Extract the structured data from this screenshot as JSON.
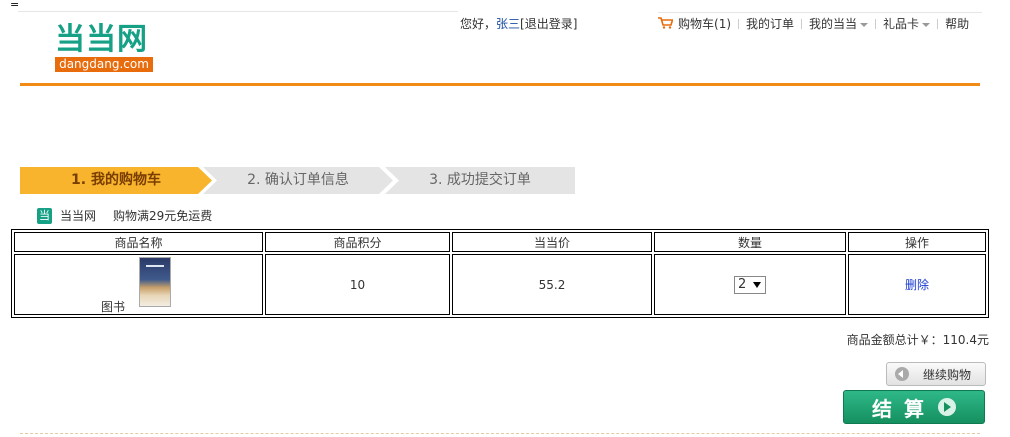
{
  "page": {
    "corner_mark": "="
  },
  "logo": {
    "text": "当当网",
    "sub": "dangdang.com"
  },
  "header": {
    "greeting_prefix": "您好，",
    "username": "张三",
    "logout_label": "[退出登录]"
  },
  "topnav": {
    "cart_label": "购物车",
    "cart_count": "(1)",
    "orders_label": "我的订单",
    "my_dangdang_label": "我的当当",
    "gift_card_label": "礼品卡",
    "help_label": "帮助"
  },
  "steps": [
    {
      "label": "1. 我的购物车",
      "active": true,
      "color": "#f7b42c"
    },
    {
      "label": "2. 确认订单信息",
      "active": false,
      "color": "#e4e4e4"
    },
    {
      "label": "3. 成功提交订单",
      "active": false,
      "color": "#e4e4e4"
    }
  ],
  "shop": {
    "icon_char": "当",
    "name": "当当网",
    "promo": "购物满29元免运费"
  },
  "table": {
    "headers": [
      "商品名称",
      "商品积分",
      "当当价",
      "数量",
      "操作"
    ],
    "rows": [
      {
        "category": "图书",
        "points": "10",
        "price": "55.2",
        "quantity": "2",
        "action": "删除"
      }
    ]
  },
  "summary": {
    "total_label": "商品金额总计￥：",
    "total_value": "110.4元"
  },
  "buttons": {
    "continue": "继续购物",
    "checkout": "结算"
  },
  "icons": {
    "cart": "cart-icon",
    "caret": "chevron-down-icon",
    "continue": "arrow-left-circle-icon",
    "checkout": "arrow-right-circle-icon"
  },
  "colors": {
    "brand_orange": "#f18b16",
    "brand_green": "#16a085",
    "link_blue": "#1a3cd0"
  }
}
